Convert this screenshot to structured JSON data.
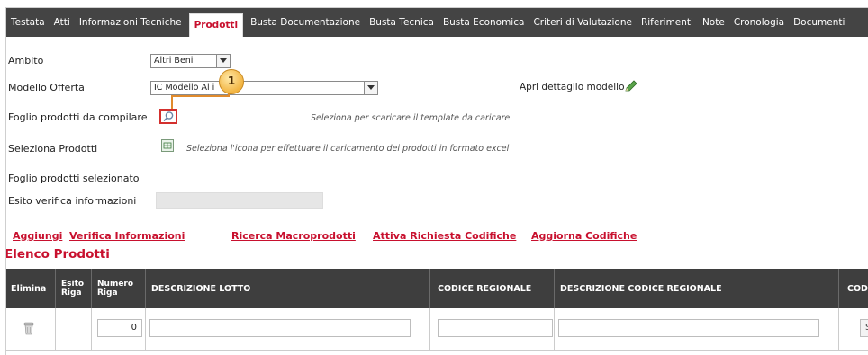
{
  "tabs": [
    {
      "label": "Testata"
    },
    {
      "label": "Atti"
    },
    {
      "label": "Informazioni Tecniche"
    },
    {
      "label": "Prodotti",
      "active": true
    },
    {
      "label": "Busta Documentazione"
    },
    {
      "label": "Busta Tecnica"
    },
    {
      "label": "Busta Economica"
    },
    {
      "label": "Criteri di Valutazione"
    },
    {
      "label": "Riferimenti"
    },
    {
      "label": "Note"
    },
    {
      "label": "Cronologia"
    },
    {
      "label": "Documenti"
    }
  ],
  "form": {
    "ambito_label": "Ambito",
    "ambito_value": "Altri Beni",
    "modello_label": "Modello Offerta",
    "modello_value": "IC Modello Al     i",
    "apri_dettaglio": "Apri dettaglio modello",
    "foglio_label": "Foglio prodotti da compilare",
    "foglio_hint": "Seleziona per scaricare il template da caricare",
    "seleziona_label": "Seleziona Prodotti",
    "seleziona_hint": "Seleziona l'icona per effettuare il caricamento dei prodotti in formato excel",
    "foglio_selezionato_label": "Foglio prodotti selezionato",
    "esito_label": "Esito verifica informazioni"
  },
  "callout": {
    "number": "1"
  },
  "actions": {
    "aggiungi": "Aggiungi",
    "verifica": "Verifica Informazioni",
    "ricerca": "Ricerca Macroprodotti",
    "attiva": "Attiva Richiesta Codifiche",
    "aggiorna": "Aggiorna Codifiche"
  },
  "list_title": "Elenco Prodotti",
  "grid": {
    "headers": {
      "elimina": "Elimina",
      "esito_riga": "Esito Riga",
      "numero_riga": "Numero Riga",
      "descrizione_lotto": "DESCRIZIONE LOTTO",
      "codice_regionale": "CODICE REGIONALE",
      "descrizione_codice_regionale": "DESCRIZIONE CODICE REGIONALE",
      "codice_partial": "CODI"
    },
    "rows": [
      {
        "numero_riga": "0",
        "select_partial": "Sel"
      }
    ]
  },
  "colors": {
    "accent": "#c8102e",
    "tabbar": "#444444",
    "grid_header": "#3e3e3e",
    "callout": "#f2b441"
  },
  "icons": [
    "search-icon",
    "pencil-icon",
    "excel-icon",
    "trash-icon",
    "chevron-down-icon"
  ]
}
